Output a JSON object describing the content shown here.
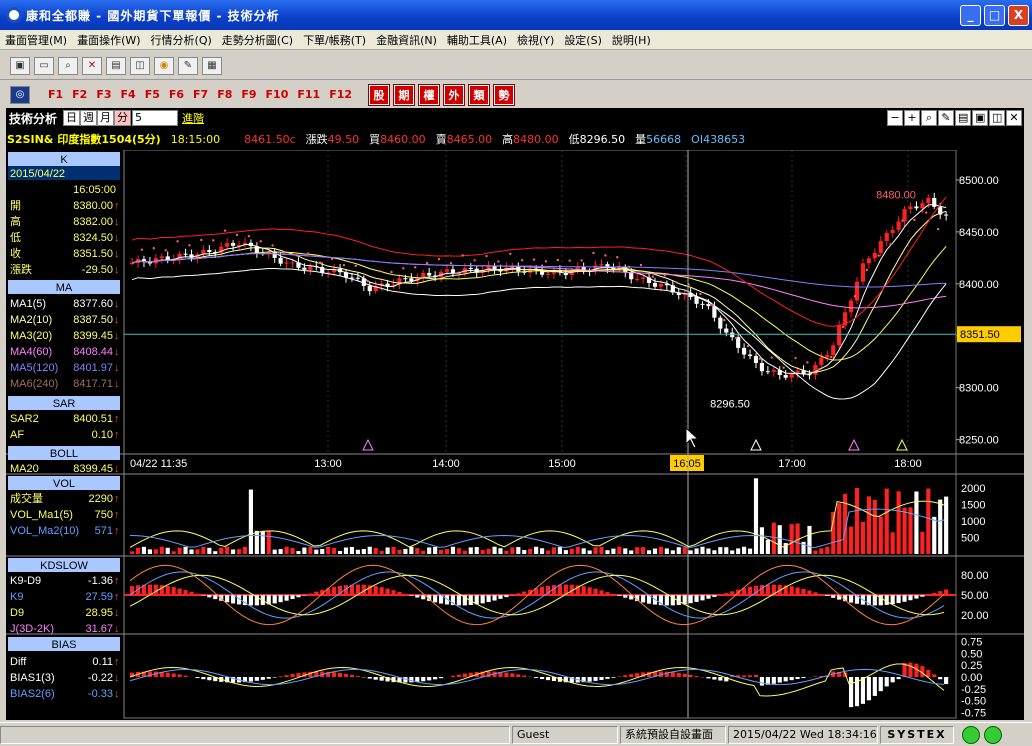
{
  "window": {
    "title": "康和全都賺 - 國外期貨下單報價 - 技術分析",
    "min": "_",
    "max": "□",
    "close": "X"
  },
  "menu": [
    "畫面管理(M)",
    "畫面操作(W)",
    "行情分析(Q)",
    "走勢分析圖(C)",
    "下單/帳務(T)",
    "金融資訊(N)",
    "輔助工具(A)",
    "檢視(Y)",
    "設定(S)",
    "說明(H)"
  ],
  "fkeys": [
    "F1",
    "F2",
    "F3",
    "F4",
    "F5",
    "F6",
    "F7",
    "F8",
    "F9",
    "F10",
    "F11",
    "F12"
  ],
  "catkeys": [
    "股",
    "期",
    "權",
    "外",
    "類",
    "勢"
  ],
  "header": {
    "label": "技術分析",
    "periods": [
      "日",
      "週",
      "月",
      "分"
    ],
    "minutes": "5",
    "advanced": "進階"
  },
  "quote": {
    "symbol": "S2SIN&",
    "name": "印度指數1504(5分)",
    "time": "18:15:00",
    "last": "8461.50c",
    "change_label": "漲跌",
    "change": "49.50",
    "bid_label": "買",
    "bid": "8460.00",
    "ask_label": "賣",
    "ask": "8465.00",
    "high_label": "高",
    "high": "8480.00",
    "low_label": "低",
    "low": "8296.50",
    "vol_label": "量",
    "vol": "56668",
    "oi_label": "OI",
    "oi": "438653"
  },
  "price_panel": {
    "title": "K",
    "date": "2015/04/22",
    "time": "16:05:00",
    "rows": [
      {
        "label": "開",
        "value": "8380.00",
        "arrow": "↑"
      },
      {
        "label": "高",
        "value": "8382.00",
        "arrow": "↓"
      },
      {
        "label": "低",
        "value": "8324.50",
        "arrow": "↓"
      },
      {
        "label": "收",
        "value": "8351.50",
        "arrow": "↓"
      },
      {
        "label": "漲跌",
        "value": "-29.50",
        "arrow": "↓"
      }
    ]
  },
  "ma_panel": {
    "title": "MA",
    "rows": [
      {
        "label": "MA1(5)",
        "value": "8377.60",
        "arrow": "↓",
        "color": "#ffffff"
      },
      {
        "label": "MA2(10)",
        "value": "8387.50",
        "arrow": "↓",
        "color": "#ffffa0"
      },
      {
        "label": "MA3(20)",
        "value": "8399.45",
        "arrow": "↓",
        "color": "#ffff60"
      },
      {
        "label": "MA4(60)",
        "value": "8408.44",
        "arrow": "↓",
        "color": "#ff80ff"
      },
      {
        "label": "MA5(120)",
        "value": "8401.97",
        "arrow": "↓",
        "color": "#8080ff"
      },
      {
        "label": "MA6(240)",
        "value": "8417.71",
        "arrow": "↓",
        "color": "#a07060"
      }
    ]
  },
  "sar_panel": {
    "title": "SAR",
    "rows": [
      {
        "label": "SAR2",
        "value": "8400.51",
        "arrow": "↑"
      },
      {
        "label": "AF",
        "value": "0.10",
        "arrow": "↑"
      }
    ]
  },
  "boll_panel": {
    "title": "BOLL",
    "rows": [
      {
        "label": "MA20",
        "value": "8399.45",
        "arrow": "↓"
      }
    ]
  },
  "vol_panel": {
    "title": "VOL",
    "rows": [
      {
        "label": "成交量",
        "value": "2290",
        "arrow": "↑",
        "color": "#ffff60"
      },
      {
        "label": "VOL_Ma1(5)",
        "value": "750",
        "arrow": "↑",
        "color": "#ffff60"
      },
      {
        "label": "VOL_Ma2(10)",
        "value": "571",
        "arrow": "↑",
        "color": "#60a0ff"
      }
    ]
  },
  "kd_panel": {
    "title": "KDSLOW",
    "rows": [
      {
        "label": "K9-D9",
        "value": "-1.36",
        "arrow": "↑",
        "color": "#ffffff"
      },
      {
        "label": "K9",
        "value": "27.59",
        "arrow": "↑",
        "color": "#60a0ff"
      },
      {
        "label": "D9",
        "value": "28.95",
        "arrow": "↓",
        "color": "#ffff60"
      },
      {
        "label": "J(3D-2K)",
        "value": "31.67",
        "arrow": "↓",
        "color": "#ff80ff"
      }
    ]
  },
  "bias_panel": {
    "title": "BIAS",
    "rows": [
      {
        "label": "Diff",
        "value": "0.11",
        "arrow": "↑",
        "color": "#ffffff"
      },
      {
        "label": "BIAS1(3)",
        "value": "-0.22",
        "arrow": "↓",
        "color": "#ffffff"
      },
      {
        "label": "BIAS2(6)",
        "value": "-0.33",
        "arrow": "↓",
        "color": "#60a0ff"
      }
    ]
  },
  "chart_data": {
    "type": "candlestick",
    "price_axis": [
      "8500.00",
      "8450.00",
      "8400.00",
      "8350.00",
      "8300.00",
      "8250.00"
    ],
    "price_range": [
      8240,
      8525
    ],
    "cursor_price": "8351.50",
    "time_axis": [
      "04/22 11:35",
      "13:00",
      "14:00",
      "15:00",
      "16:05",
      "17:00",
      "18:00"
    ],
    "cursor_time": "16:05",
    "annotations": [
      {
        "text": "8480.00",
        "price": 8480
      },
      {
        "text": "8296.50",
        "price": 8296.5
      }
    ],
    "vol_axis": [
      "2000",
      "1500",
      "1000",
      "500"
    ],
    "kd_axis": [
      "80.00",
      "50.00",
      "20.00"
    ],
    "bias_axis": [
      "0.75",
      "0.50",
      "0.25",
      "0.00",
      "-0.25",
      "-0.50",
      "-0.75"
    ]
  },
  "status": {
    "user": "Guest",
    "layout": "系統預設自設畫面",
    "datetime": "2015/04/22 Wed 18:34:16",
    "brand": "SYSTEX"
  }
}
